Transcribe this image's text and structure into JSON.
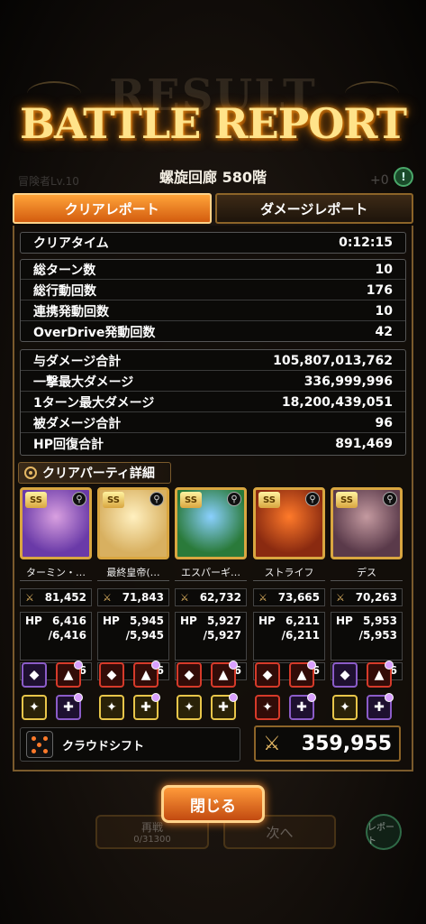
{
  "header": {
    "ghost_title": "RESULT",
    "title": "BATTLE REPORT",
    "floor": "螺旋回廊 580階"
  },
  "tabs": {
    "clear_report": "クリアレポート",
    "damage_report": "ダメージレポート"
  },
  "clear_time": {
    "label": "クリアタイム",
    "value": "0:12:15"
  },
  "turn_stats": [
    {
      "label": "総ターン数",
      "value": "10"
    },
    {
      "label": "総行動回数",
      "value": "176"
    },
    {
      "label": "連携発動回数",
      "value": "10"
    },
    {
      "label": "OverDrive発動回数",
      "value": "42"
    }
  ],
  "damage_stats": [
    {
      "label": "与ダメージ合計",
      "value": "105,807,013,762"
    },
    {
      "label": "一撃最大ダメージ",
      "value": "336,999,996"
    },
    {
      "label": "1ターン最大ダメージ",
      "value": "18,200,439,051"
    },
    {
      "label": "被ダメージ合計",
      "value": "96"
    },
    {
      "label": "HP回復合計",
      "value": "891,469"
    }
  ],
  "party_header": "クリアパーティ詳細",
  "party": [
    {
      "name": "ターミン・…",
      "power": "81,452",
      "hp": "6,416",
      "hp_max": "/6,416",
      "lp": "1/6",
      "badge": "SS",
      "colors": [
        "#6a3aa8",
        "#d9a0e0"
      ]
    },
    {
      "name": "最終皇帝(…",
      "power": "71,843",
      "hp": "5,945",
      "hp_max": "/5,945",
      "lp": "6/6",
      "badge": "SS",
      "colors": [
        "#d8b060",
        "#fff0c0"
      ]
    },
    {
      "name": "エスパーギ…",
      "power": "62,732",
      "hp": "5,927",
      "hp_max": "/5,927",
      "lp": "6/6",
      "badge": "SS",
      "colors": [
        "#2a7a3a",
        "#8ad0ff"
      ]
    },
    {
      "name": "ストライフ",
      "power": "73,665",
      "hp": "6,211",
      "hp_max": "/6,211",
      "lp": "6/6",
      "badge": "SS",
      "colors": [
        "#8a2a10",
        "#ff7a2a"
      ]
    },
    {
      "name": "デス",
      "power": "70,263",
      "hp": "5,953",
      "hp_max": "/5,953",
      "lp": "6/6",
      "badge": "SS",
      "colors": [
        "#5a3a4a",
        "#c49aa0"
      ]
    }
  ],
  "labels": {
    "hp": "HP",
    "lp": "LP"
  },
  "cloud_shift": "クラウドシフト",
  "total_power": "359,955",
  "buttons": {
    "close": "閉じる",
    "retry": "再戦",
    "retry_count": "0/31300",
    "next": "次へ",
    "report": "レポート"
  },
  "background_ghost": {
    "adventurer": "冒険者Lv.10",
    "plus": "+0"
  }
}
